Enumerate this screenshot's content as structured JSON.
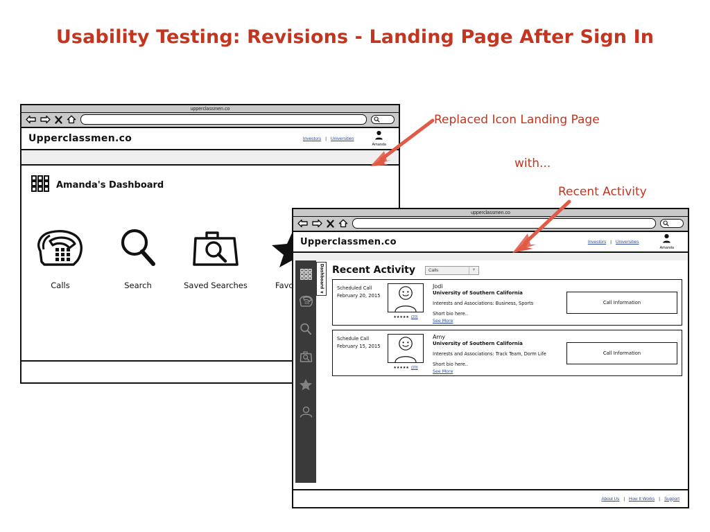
{
  "slide": {
    "title": "Usability Testing:  Revisions - Landing Page After Sign In",
    "accent_color": "#C3351F"
  },
  "annotations": [
    {
      "id": "replaced",
      "text": "Replaced Icon Landing Page"
    },
    {
      "id": "with",
      "text": "with..."
    },
    {
      "id": "recent",
      "text": "Recent Activity"
    }
  ],
  "window1": {
    "browser": {
      "title": "upperclassmen.co",
      "url_value": "",
      "url_placeholder": "",
      "search_value": "",
      "nav_icons": [
        "back-arrow-icon",
        "forward-arrow-icon",
        "close-icon",
        "home-icon",
        "search-icon"
      ]
    },
    "header": {
      "brand": "Upperclassmen.co",
      "links": [
        "Investors",
        "Universities"
      ],
      "separator": "|",
      "avatar_icon": "user-avatar-icon",
      "avatar_name": "Amanda"
    },
    "dashboard": {
      "grid_icon": "grid-icon",
      "title": "Amanda's Dashboard",
      "tiles": [
        {
          "icon": "phone-icon",
          "label": "Calls"
        },
        {
          "icon": "magnifier-icon",
          "label": "Search"
        },
        {
          "icon": "folder-search-icon",
          "label": "Saved Searches"
        },
        {
          "icon": "star-icon",
          "label": "Favorites"
        }
      ]
    }
  },
  "window2": {
    "browser": {
      "title": "upperclassmen.co",
      "url_value": "",
      "search_value": "",
      "nav_icons": [
        "back-arrow-icon",
        "forward-arrow-icon",
        "close-icon",
        "home-icon",
        "search-icon"
      ]
    },
    "header": {
      "brand": "Upperclassmen.co",
      "links": [
        "Investors",
        "Universities"
      ],
      "separator": "|",
      "avatar_icon": "user-avatar-icon",
      "avatar_name": "Amanda"
    },
    "sidebar": {
      "tab_label": "Dashboard ∨",
      "items": [
        {
          "icon": "grid-icon",
          "name": "dashboard",
          "active": true
        },
        {
          "icon": "phone-icon",
          "name": "calls",
          "active": false
        },
        {
          "icon": "magnifier-icon",
          "name": "search",
          "active": false
        },
        {
          "icon": "folder-search-icon",
          "name": "saved-searches",
          "active": false
        },
        {
          "icon": "star-icon",
          "name": "favorites",
          "active": false
        },
        {
          "icon": "user-icon",
          "name": "profile",
          "active": false
        }
      ]
    },
    "recent_activity": {
      "heading": "Recent Activity",
      "filter_selected": "Calls",
      "filter_options": [
        "Calls"
      ],
      "cards": [
        {
          "status": "Scheduled Call",
          "date": "February 20, 2015",
          "photo_icon": "person-photo-icon",
          "stars": "★★★★★",
          "rating_count": "(20)",
          "name": "Jodi",
          "school": "University of Southern California",
          "interests": "Interests and Associations:  Business, Sports",
          "bio": "Short bio here..",
          "see_more": "See More",
          "action_label": "Call Information"
        },
        {
          "status": "Schedule Call",
          "date": "February 15, 2015",
          "photo_icon": "person-photo-icon",
          "stars": "★★★★★",
          "rating_count": "(20)",
          "name": "Amy",
          "school": "University of Southern California",
          "interests": "Interests and Associations:  Track Team, Dorm Life",
          "bio": "Short bio here..",
          "see_more": "See More",
          "action_label": "Call Information"
        }
      ]
    },
    "footer": {
      "links": [
        "About Us",
        "How It Works",
        "Support"
      ],
      "separator": "|"
    }
  }
}
